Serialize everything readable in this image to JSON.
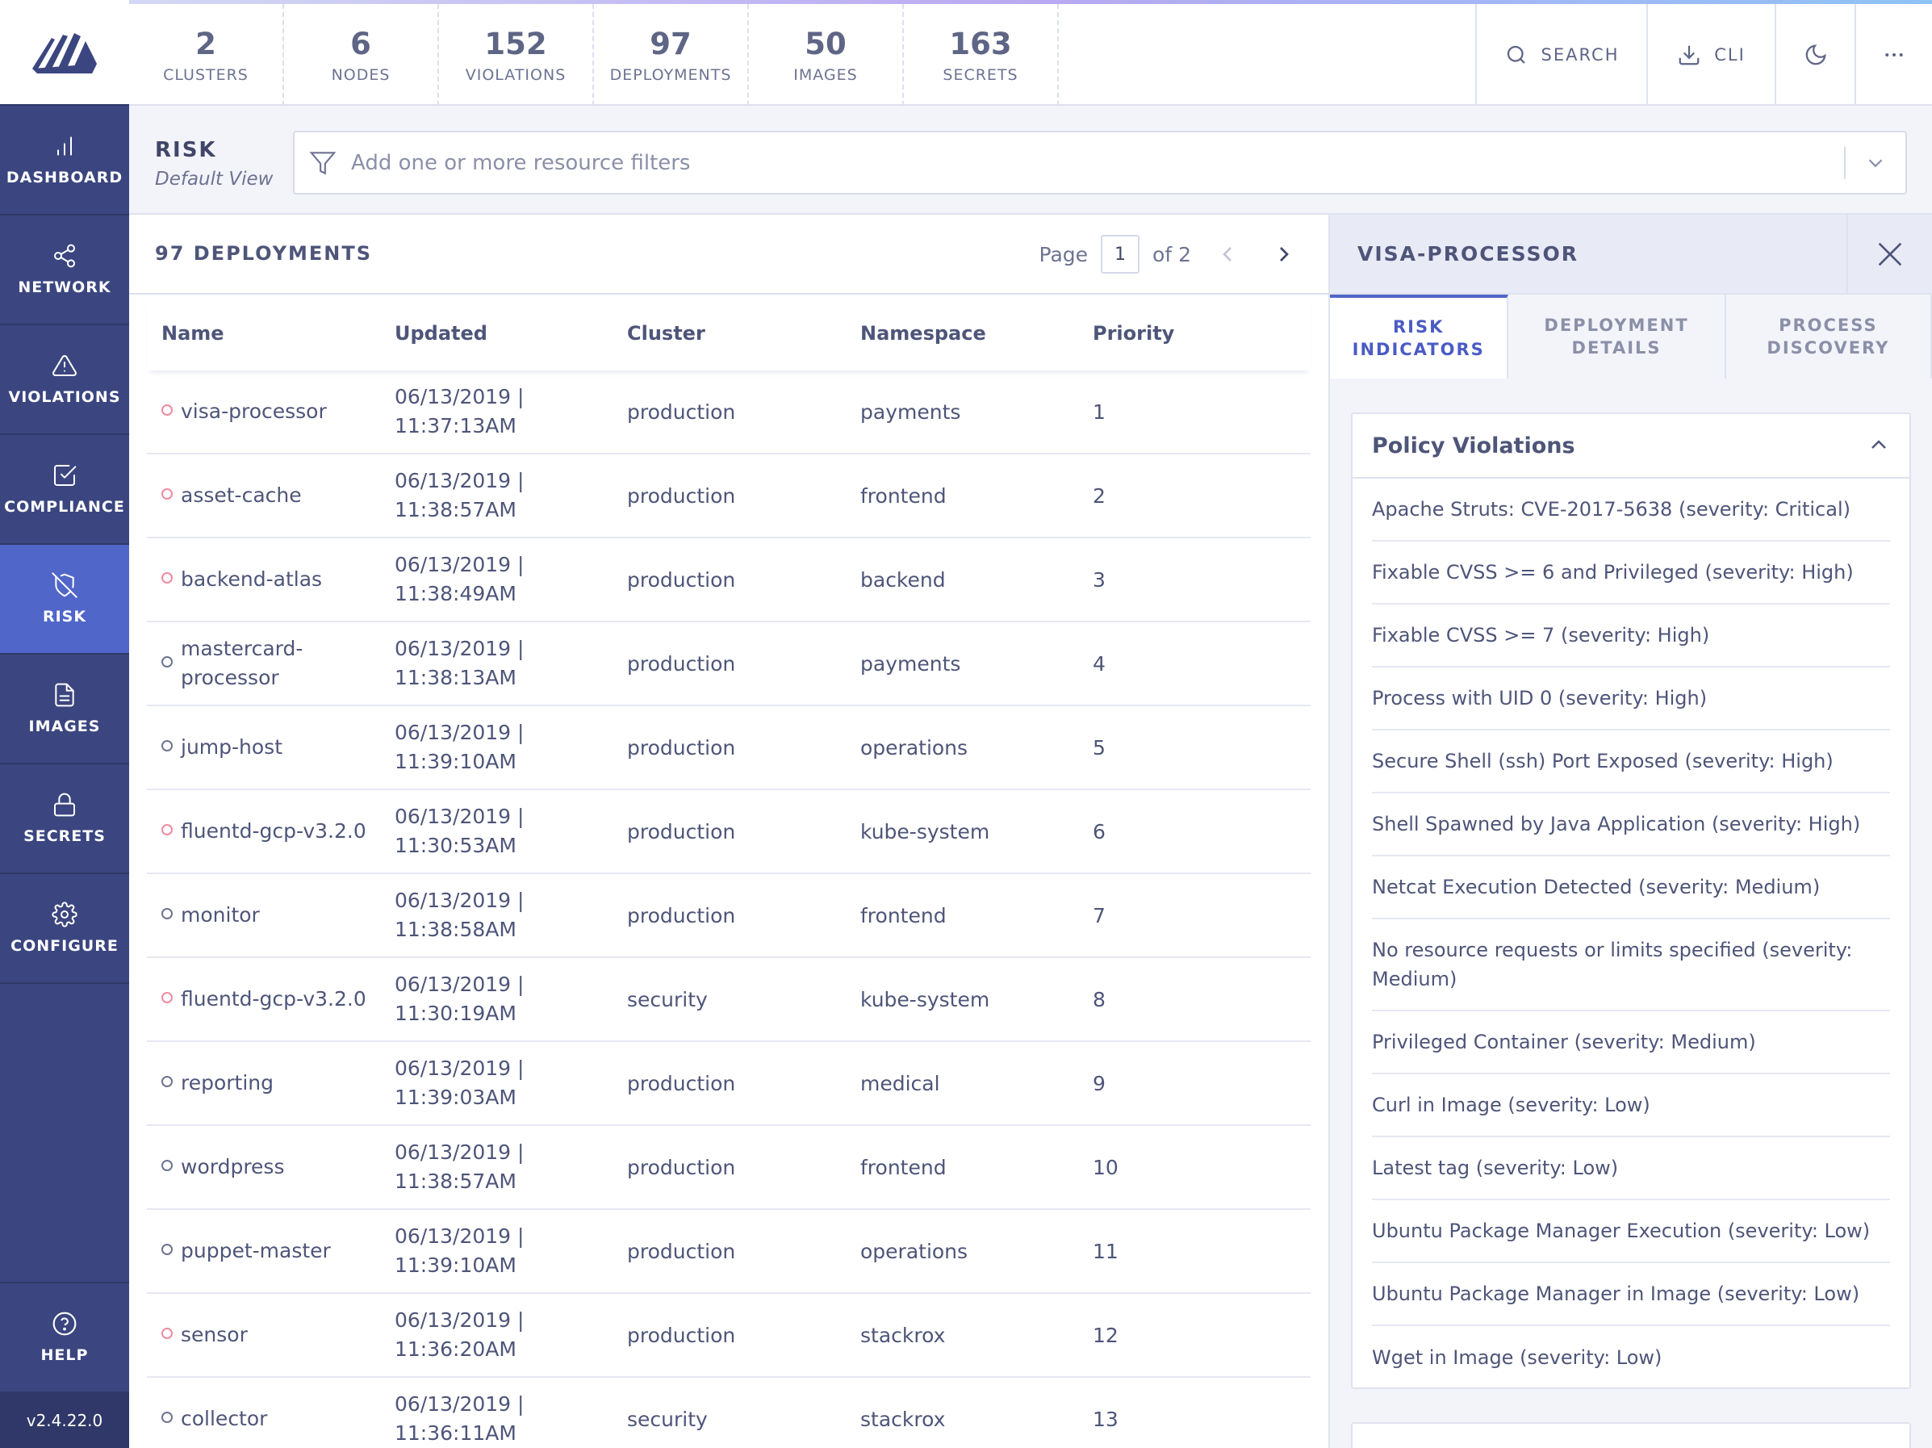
{
  "nav": {
    "items": [
      {
        "label": "DASHBOARD",
        "icon": "bar-chart-icon"
      },
      {
        "label": "NETWORK",
        "icon": "share-icon"
      },
      {
        "label": "VIOLATIONS",
        "icon": "alert-triangle-icon"
      },
      {
        "label": "COMPLIANCE",
        "icon": "check-square-icon"
      },
      {
        "label": "RISK",
        "icon": "shield-off-icon"
      },
      {
        "label": "IMAGES",
        "icon": "file-icon"
      },
      {
        "label": "SECRETS",
        "icon": "lock-icon"
      },
      {
        "label": "CONFIGURE",
        "icon": "gear-icon"
      }
    ],
    "active": "RISK",
    "help_label": "HELP",
    "version": "v2.4.22.0"
  },
  "summary": [
    {
      "count": "2",
      "label": "CLUSTERS"
    },
    {
      "count": "6",
      "label": "NODES"
    },
    {
      "count": "152",
      "label": "VIOLATIONS"
    },
    {
      "count": "97",
      "label": "DEPLOYMENTS"
    },
    {
      "count": "50",
      "label": "IMAGES"
    },
    {
      "count": "163",
      "label": "SECRETS"
    }
  ],
  "toolbar": {
    "search_label": "SEARCH",
    "cli_label": "CLI"
  },
  "page": {
    "title": "RISK",
    "subtitle": "Default View",
    "filter_placeholder": "Add one or more resource filters"
  },
  "list": {
    "title": "97 DEPLOYMENTS",
    "pager": {
      "label": "Page",
      "current": "1",
      "of": "of 2"
    },
    "columns": {
      "name": "Name",
      "updated": "Updated",
      "cluster": "Cluster",
      "namespace": "Namespace",
      "priority": "Priority"
    },
    "rows": [
      {
        "name": "visa-processor",
        "date": "06/13/2019 |",
        "time": "11:37:13AM",
        "cluster": "production",
        "namespace": "payments",
        "priority": "1",
        "high": true
      },
      {
        "name": "asset-cache",
        "date": "06/13/2019 |",
        "time": "11:38:57AM",
        "cluster": "production",
        "namespace": "frontend",
        "priority": "2",
        "high": true
      },
      {
        "name": "backend-atlas",
        "date": "06/13/2019 |",
        "time": "11:38:49AM",
        "cluster": "production",
        "namespace": "backend",
        "priority": "3",
        "high": true
      },
      {
        "name": "mastercard-processor",
        "date": "06/13/2019 |",
        "time": "11:38:13AM",
        "cluster": "production",
        "namespace": "payments",
        "priority": "4",
        "high": false
      },
      {
        "name": "jump-host",
        "date": "06/13/2019 |",
        "time": "11:39:10AM",
        "cluster": "production",
        "namespace": "operations",
        "priority": "5",
        "high": false
      },
      {
        "name": "fluentd-gcp-v3.2.0",
        "date": "06/13/2019 |",
        "time": "11:30:53AM",
        "cluster": "production",
        "namespace": "kube-system",
        "priority": "6",
        "high": true
      },
      {
        "name": "monitor",
        "date": "06/13/2019 |",
        "time": "11:38:58AM",
        "cluster": "production",
        "namespace": "frontend",
        "priority": "7",
        "high": false
      },
      {
        "name": "fluentd-gcp-v3.2.0",
        "date": "06/13/2019 |",
        "time": "11:30:19AM",
        "cluster": "security",
        "namespace": "kube-system",
        "priority": "8",
        "high": true
      },
      {
        "name": "reporting",
        "date": "06/13/2019 |",
        "time": "11:39:03AM",
        "cluster": "production",
        "namespace": "medical",
        "priority": "9",
        "high": false
      },
      {
        "name": "wordpress",
        "date": "06/13/2019 |",
        "time": "11:38:57AM",
        "cluster": "production",
        "namespace": "frontend",
        "priority": "10",
        "high": false
      },
      {
        "name": "puppet-master",
        "date": "06/13/2019 |",
        "time": "11:39:10AM",
        "cluster": "production",
        "namespace": "operations",
        "priority": "11",
        "high": false
      },
      {
        "name": "sensor",
        "date": "06/13/2019 |",
        "time": "11:36:20AM",
        "cluster": "production",
        "namespace": "stackrox",
        "priority": "12",
        "high": true
      },
      {
        "name": "collector",
        "date": "06/13/2019 |",
        "time": "11:36:11AM",
        "cluster": "security",
        "namespace": "stackrox",
        "priority": "13",
        "high": false
      }
    ]
  },
  "side": {
    "title": "VISA-PROCESSOR",
    "tabs": [
      {
        "label_line1": "RISK",
        "label_line2": "INDICATORS"
      },
      {
        "label_line1": "DEPLOYMENT",
        "label_line2": "DETAILS"
      },
      {
        "label_line1": "PROCESS",
        "label_line2": "DISCOVERY"
      }
    ],
    "card_title": "Policy Violations",
    "violations": [
      "Apache Struts: CVE-2017-5638 (severity: Critical)",
      "Fixable CVSS >= 6 and Privileged (severity: High)",
      "Fixable CVSS >= 7 (severity: High)",
      "Process with UID 0 (severity: High)",
      "Secure Shell (ssh) Port Exposed (severity: High)",
      "Shell Spawned by Java Application (severity: High)",
      "Netcat Execution Detected (severity: Medium)",
      "No resource requests or limits specified (severity: Medium)",
      "Privileged Container (severity: Medium)",
      "Curl in Image (severity: Low)",
      "Latest tag (severity: Low)",
      "Ubuntu Package Manager Execution (severity: Low)",
      "Ubuntu Package Manager in Image (severity: Low)",
      "Wget in Image (severity: Low)"
    ]
  },
  "colors": {
    "nav_bg": "#3b4680",
    "nav_active": "#5166c9",
    "accent": "#4a5bc4",
    "high_risk_dot": "#ef8b9f"
  }
}
